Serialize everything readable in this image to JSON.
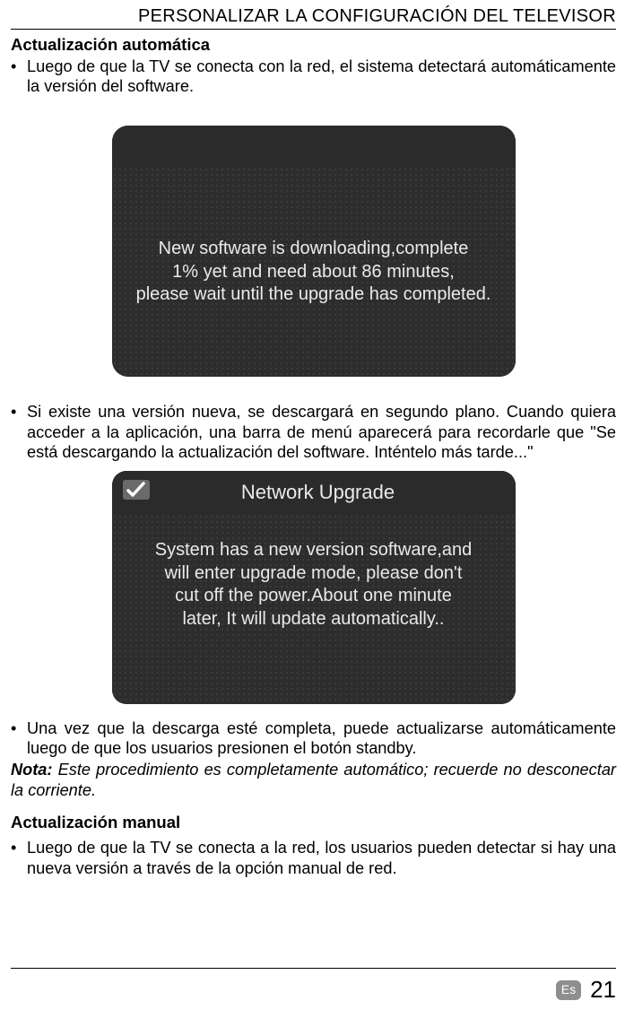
{
  "header": {
    "title": "PERSONALIZAR LA CONFIGURACIÓN DEL TELEVISOR"
  },
  "auto": {
    "heading": "Actualización automática",
    "b1": "Luego de que la TV se conecta con la red, el sistema detectará automáticamente la versión del software.",
    "b2": "Si existe una versión nueva, se descargará en segundo plano. Cuando quiera acceder a la aplicación, una barra de menú aparecerá para recordarle que \"Se está descargando la actualización del software. Inténtelo más tarde...\"",
    "b3": "Una vez que la descarga esté completa, puede actualizarse automáticamente luego de que los usuarios presionen el botón standby."
  },
  "note": {
    "label": "Nota:",
    "text": " Este procedimiento es completamente automático; recuerde no desconectar la corriente."
  },
  "manual": {
    "heading": "Actualización manual",
    "b1": "Luego de que la TV se conecta a la red, los usuarios pueden detectar si hay una nueva versión a través de la opción manual de red."
  },
  "dialog1": {
    "line1": "New software is downloading,complete",
    "line2": "1% yet and need about 86 minutes,",
    "line3": "please wait until the upgrade has completed."
  },
  "dialog2": {
    "title": "Network Upgrade",
    "line1": "System has a new version software,and",
    "line2": "will enter upgrade mode, please don't",
    "line3": "cut off the power.About one minute",
    "line4": "later, It will update automatically.."
  },
  "footer": {
    "lang": "Es",
    "page": "21"
  }
}
